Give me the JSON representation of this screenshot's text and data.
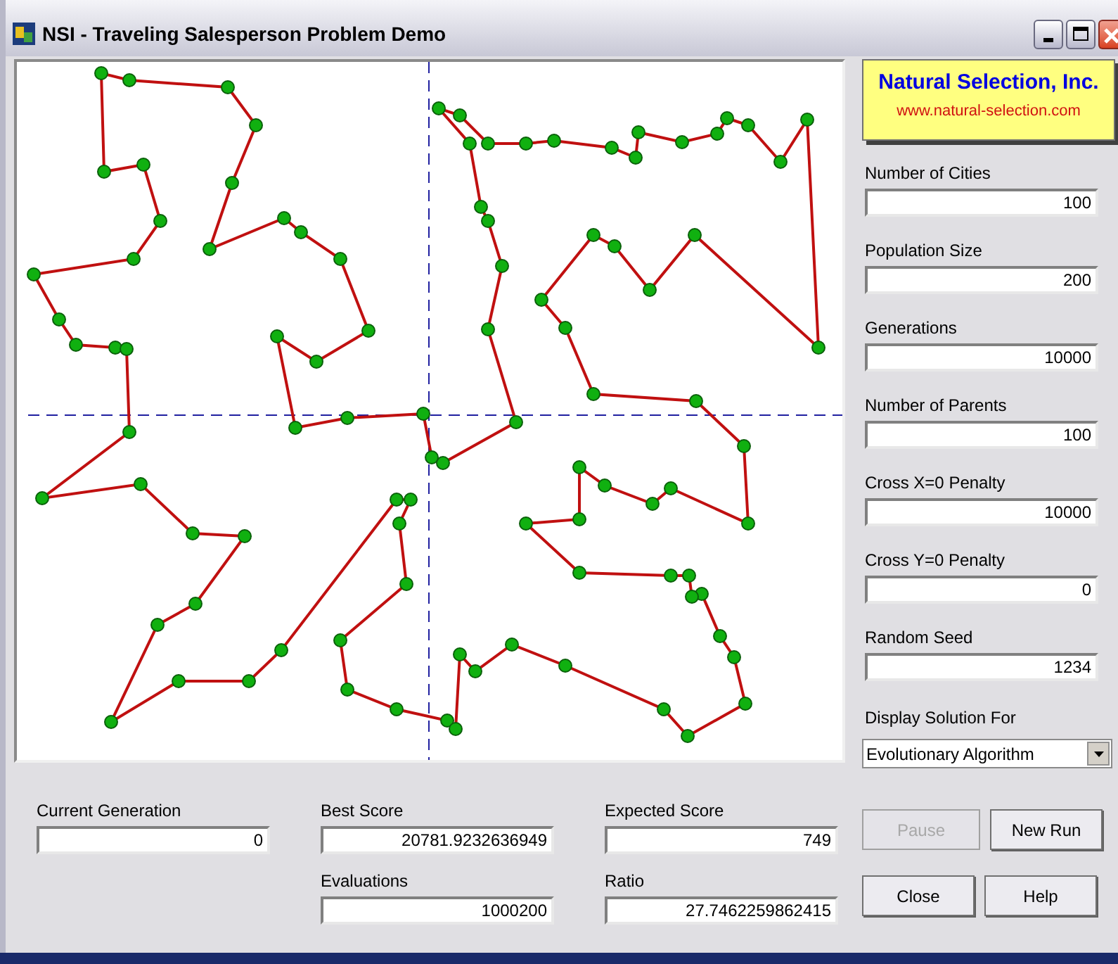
{
  "window": {
    "title": "NSI - Traveling Salesperson Problem Demo"
  },
  "logo": {
    "company": "Natural Selection, Inc.",
    "url": "www.natural-selection.com"
  },
  "parameters": [
    {
      "label": "Number of Cities",
      "value": "100"
    },
    {
      "label": "Population Size",
      "value": "200"
    },
    {
      "label": "Generations",
      "value": "10000"
    },
    {
      "label": "Number of Parents",
      "value": "100"
    },
    {
      "label": "Cross X=0 Penalty",
      "value": "10000"
    },
    {
      "label": "Cross Y=0 Penalty",
      "value": "0"
    },
    {
      "label": "Random Seed",
      "value": "1234"
    }
  ],
  "display_solution": {
    "label": "Display Solution For",
    "value": "Evolutionary Algorithm"
  },
  "stats": [
    [
      {
        "label": "Current Generation",
        "value": "0"
      },
      {
        "label": "Best Score",
        "value": "20781.9232636949"
      },
      {
        "label": "Expected Score",
        "value": "749"
      }
    ],
    [
      {
        "label": "Evaluations",
        "value": "1000200"
      },
      {
        "label": "Ratio",
        "value": "27.7462259862415"
      }
    ]
  ],
  "buttons": [
    [
      {
        "label": "Pause",
        "disabled": true
      },
      {
        "label": "New Run",
        "disabled": false
      }
    ],
    [
      {
        "label": "Close",
        "disabled": false
      },
      {
        "label": "Help",
        "disabled": false
      }
    ]
  ]
}
